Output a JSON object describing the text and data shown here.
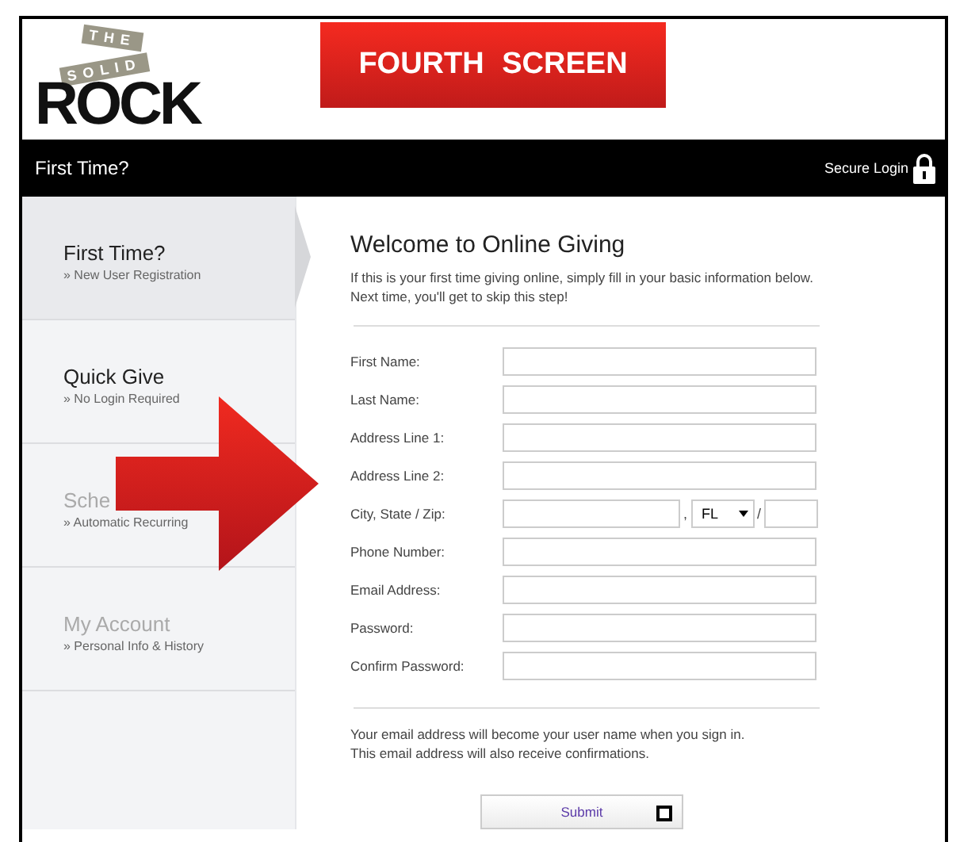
{
  "logo": {
    "words": [
      "THE",
      "SOLID",
      "ROCK"
    ]
  },
  "banner": {
    "label": "FOURTH SCREEN"
  },
  "nav_bar": {
    "title": "First Time?",
    "login": "Secure Login"
  },
  "sidebar": {
    "items": [
      {
        "title": "First Time?",
        "subtitle": "» New User Registration",
        "selected": true,
        "disabled": false
      },
      {
        "title": "Quick Give",
        "subtitle": "» No Login Required",
        "selected": false,
        "disabled": false
      },
      {
        "title": "Sche",
        "subtitle": "» Automatic Recurring",
        "selected": false,
        "disabled": true
      },
      {
        "title": "My Account",
        "subtitle": "» Personal Info & History",
        "selected": false,
        "disabled": true
      }
    ]
  },
  "form": {
    "heading": "Welcome to Online Giving",
    "intro": "If this is your first time giving online, simply fill in your basic information below. Next time, you'll get to skip this step!",
    "rows": [
      {
        "kind": "text",
        "label": "First Name:"
      },
      {
        "kind": "text",
        "label": "Last Name:"
      },
      {
        "kind": "text",
        "label": "Address Line 1:"
      },
      {
        "kind": "text",
        "label": "Address Line 2:"
      },
      {
        "kind": "citystatezip",
        "label": "City, State / Zip:",
        "comma": ",",
        "state": "FL",
        "slash": "/"
      },
      {
        "kind": "text",
        "label": "Phone Number:"
      },
      {
        "kind": "text",
        "label": "Email Address:"
      },
      {
        "kind": "text",
        "label": "Password:"
      },
      {
        "kind": "text",
        "label": "Confirm Password:"
      }
    ],
    "note": "Your email address will become your user name when you sign in. This email address will also receive confirmations.",
    "submit": "Submit"
  }
}
